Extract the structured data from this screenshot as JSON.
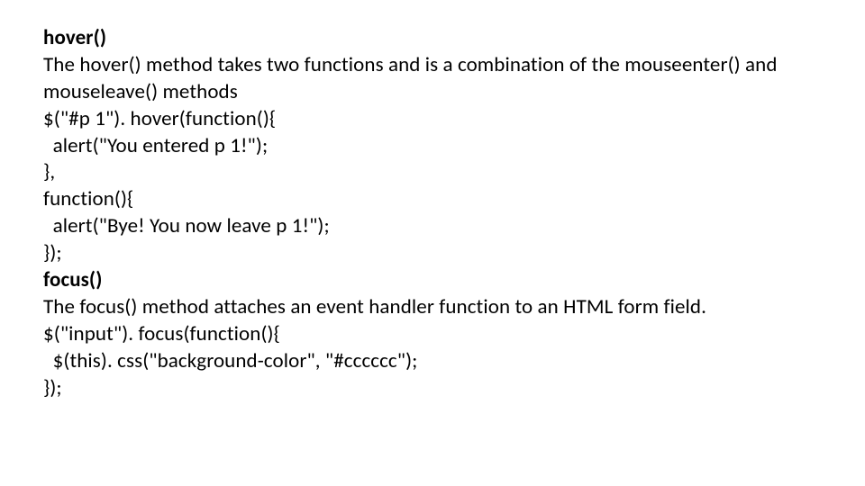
{
  "slide": {
    "lines": [
      {
        "text": "hover()",
        "bold": true
      },
      {
        "text": "The hover() method takes two functions and is a combination of the mouseenter() and mouseleave() methods",
        "bold": false
      },
      {
        "text": "$(\"#p 1\"). hover(function(){\n  alert(\"You entered p 1!\");\n},\nfunction(){\n  alert(\"Bye! You now leave p 1!\");\n});",
        "bold": false
      },
      {
        "text": "focus()",
        "bold": true
      },
      {
        "text": "The focus() method attaches an event handler function to an HTML form field.",
        "bold": false
      },
      {
        "text": "$(\"input\"). focus(function(){\n  $(this). css(\"background-color\", \"#cccccc\");\n});",
        "bold": false
      }
    ]
  }
}
